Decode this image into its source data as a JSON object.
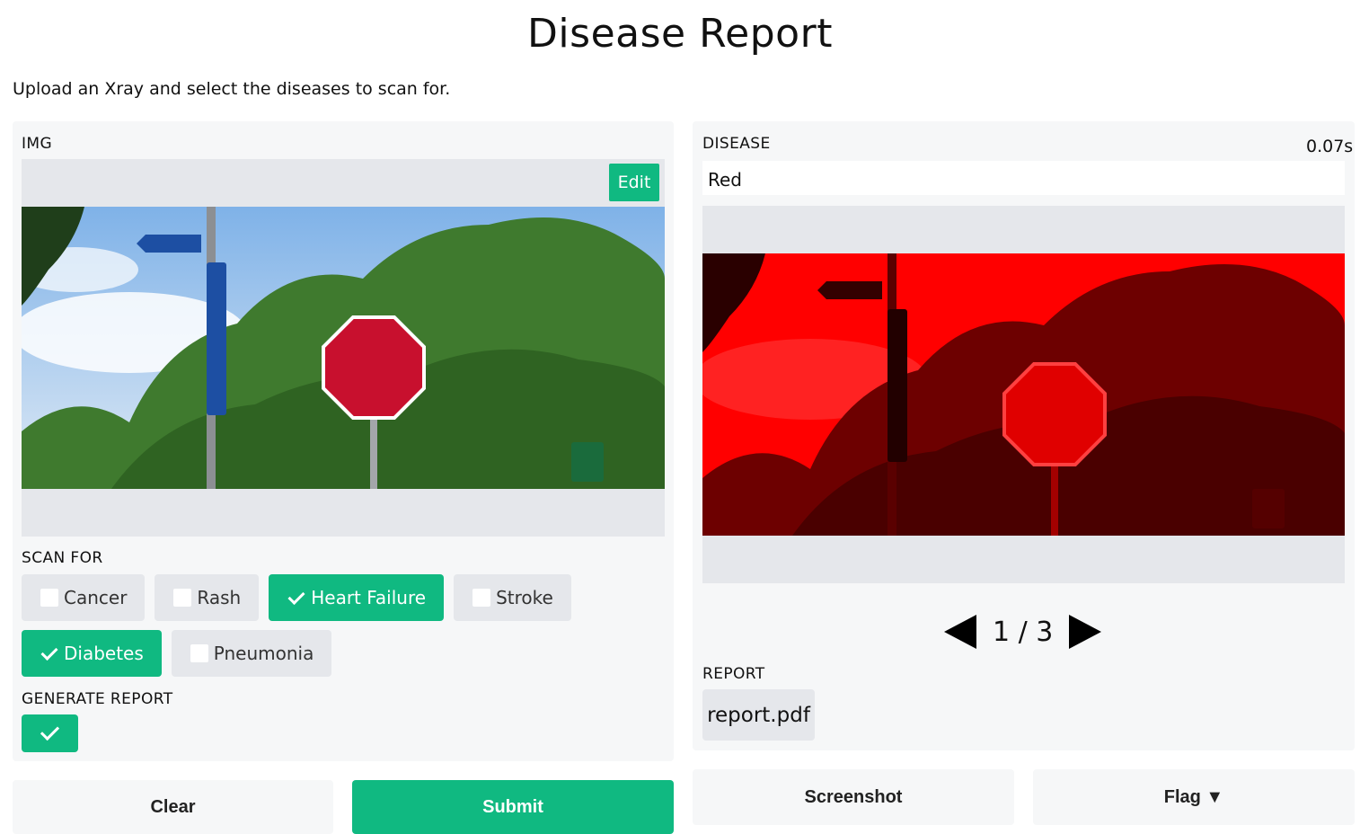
{
  "header": {
    "title": "Disease Report",
    "description": "Upload an Xray and select the diseases to scan for."
  },
  "input_panel": {
    "image_label": "IMG",
    "edit_label": "Edit",
    "scan_label": "SCAN FOR",
    "options": [
      {
        "label": "Cancer",
        "checked": false
      },
      {
        "label": "Rash",
        "checked": false
      },
      {
        "label": "Heart Failure",
        "checked": true
      },
      {
        "label": "Stroke",
        "checked": false
      },
      {
        "label": "Diabetes",
        "checked": true
      },
      {
        "label": "Pneumonia",
        "checked": false
      }
    ],
    "generate_label": "GENERATE REPORT",
    "generate_checked": true
  },
  "actions": {
    "clear_label": "Clear",
    "submit_label": "Submit"
  },
  "output_panel": {
    "disease_label": "DISEASE",
    "elapsed": "0.07s",
    "disease_value": "Red",
    "pager": {
      "text": "1 / 3"
    },
    "report_label": "REPORT",
    "report_file": "report.pdf"
  },
  "flagging": {
    "screenshot_label": "Screenshot",
    "flag_label": "Flag ▼"
  },
  "colors": {
    "accent": "#10b981",
    "panel": "#f6f7f8",
    "frame": "#e5e7eb"
  }
}
